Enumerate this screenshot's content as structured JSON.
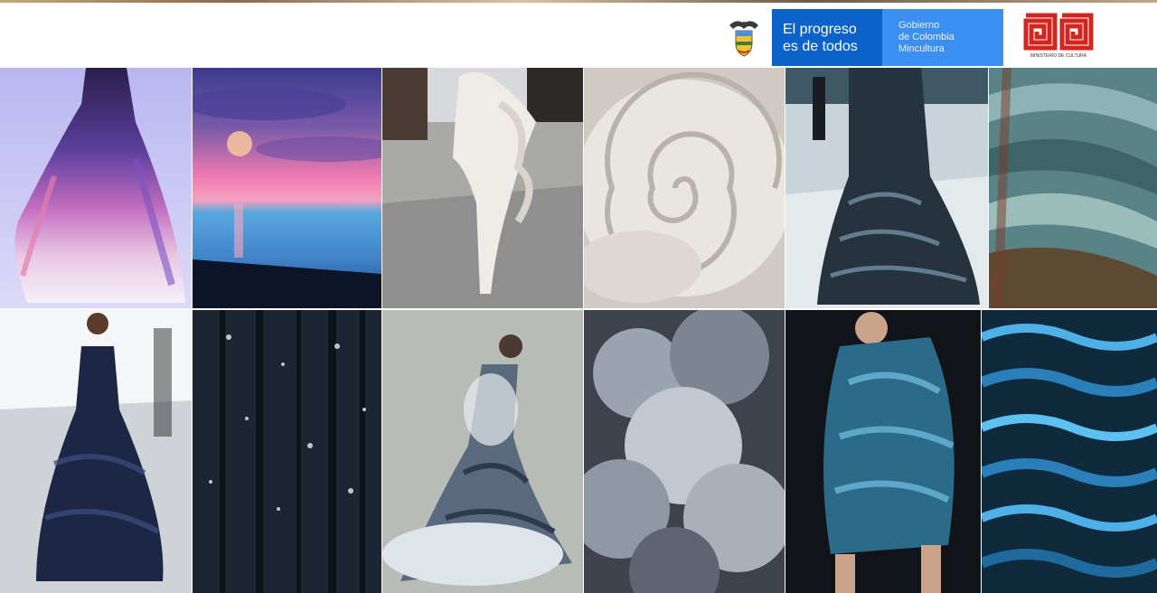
{
  "header": {
    "gov_logo": {
      "slogan_line1": "El progreso",
      "slogan_line2": "es de todos",
      "entity_line1": "Gobierno",
      "entity_line2": "de Colombia",
      "entity_line3": "Mincultura"
    },
    "mincultura_logo": {
      "caption": "MINISTERIO DE CULTURA"
    }
  },
  "colors": {
    "gov_blue_dark": "#0b63c9",
    "gov_blue_light": "#3a8ff0",
    "mincultura_red": "#d2261f"
  },
  "moodboard": {
    "tiles": [
      {
        "name": "ombre-gown-photo"
      },
      {
        "name": "pink-sunset-sea-photo"
      },
      {
        "name": "white-ruffle-outfit-photo"
      },
      {
        "name": "white-rose-swirl-photo"
      },
      {
        "name": "dark-print-gown-photo"
      },
      {
        "name": "teal-rock-layers-photo"
      },
      {
        "name": "navy-sheer-gown-photo"
      },
      {
        "name": "night-forest-stars-photo"
      },
      {
        "name": "cloud-mermaid-gown-photo"
      },
      {
        "name": "storm-clouds-photo"
      },
      {
        "name": "blue-draped-dress-photo"
      },
      {
        "name": "blue-water-ripples-photo"
      }
    ]
  }
}
